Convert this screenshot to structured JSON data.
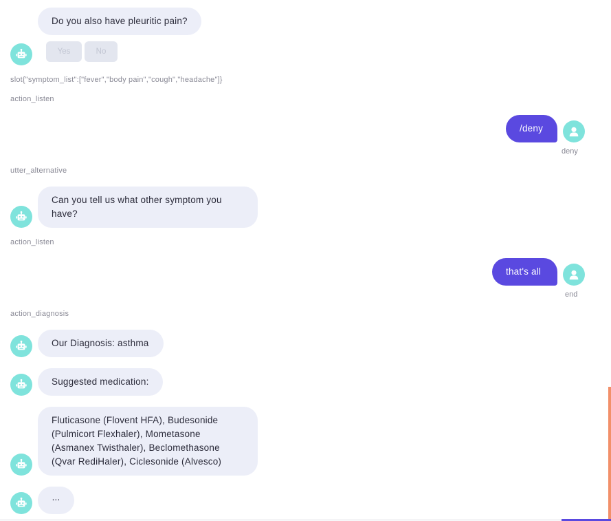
{
  "chat": {
    "q_pleuritic": "Do you also have pleuritic pain?",
    "btn_yes": "Yes",
    "btn_no": "No",
    "slot_text": "slot{\"symptom_list\":[\"fever\",\"body pain\",\"cough\",\"headache\"]}",
    "action_listen_1": "action_listen",
    "user_msg_1": "/deny",
    "user_msg_1_label": "deny",
    "utter_alternative": "utter_alternative",
    "q_other_symptom": "Can you tell us what other symptom you have?",
    "action_listen_2": "action_listen",
    "user_msg_2": "that's all",
    "user_msg_2_label": "end",
    "action_diagnosis": "action_diagnosis",
    "diagnosis": "Our Diagnosis: asthma",
    "suggested_med": "Suggested medication:",
    "medications": "Fluticasone (Flovent HFA), Budesonide (Pulmicort Flexhaler), Mometasone (Asmanex Twisthaler), Beclomethasone (Qvar RediHaler), Ciclesonide (Alvesco)",
    "typing": "..."
  },
  "icons": {
    "bot_avatar": "robot-icon",
    "user_avatar": "user-icon"
  },
  "colors": {
    "bot_bubble": "#eceef8",
    "user_bubble": "#5a49e0",
    "avatar": "#7fe3dc",
    "scroll_accent": "#f2906a"
  }
}
